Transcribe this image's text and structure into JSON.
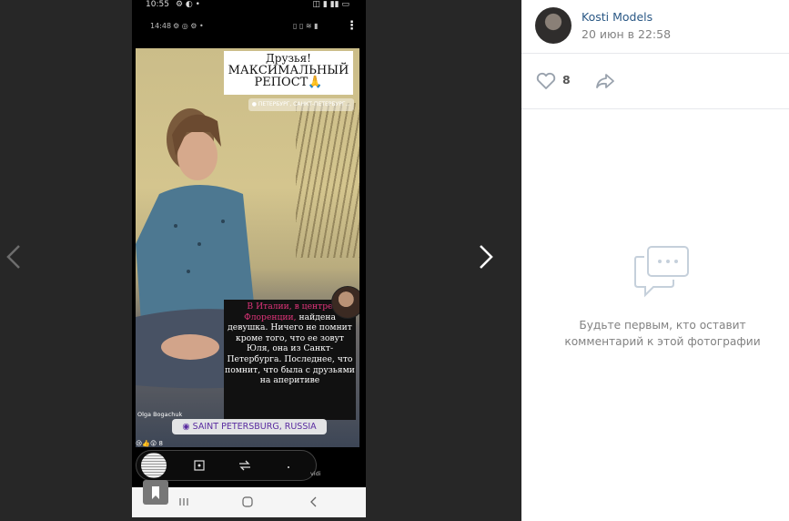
{
  "viewer": {
    "prev_icon": "chevron-left-icon",
    "next_icon": "chevron-right-icon",
    "phone": {
      "status_time": "10:55",
      "status_secondary_time": "14:48",
      "story": {
        "headline_lines": [
          "Друзья!",
          "МАКСИМАЛЬНЫЙ",
          "РЕПОСТ🙏"
        ],
        "location_tag_top": "● ПЕТЕРБУРГ, САНКТ-ПЕТЕРБУРГ...",
        "caption_pink": "В Италии, в центре Флоренции,",
        "caption_rest": "найдена девушка. Ничего не помнит кроме того, что ее зовут Юля, она из Санкт-Петербурга. Последнее, что помнит, что была с друзьями на аперитиве",
        "credit": "Olga Bogachuk",
        "location_tag": "SAINT PETERSBURG, RUSSIA",
        "reactions": "😢👍😲 8",
        "partial_text": "vidi"
      }
    }
  },
  "post": {
    "author": "Kosti Models",
    "date": "20 июн в 22:58",
    "likes": "8",
    "like_icon": "heart-icon",
    "share_icon": "share-arrow-icon",
    "empty_comments_icon": "comment-bubble-icon",
    "empty_comments_text": "Будьте первым, кто оставит комментарий к этой фотографии",
    "accent_color": "#2a5885",
    "muted_color": "#828282"
  }
}
